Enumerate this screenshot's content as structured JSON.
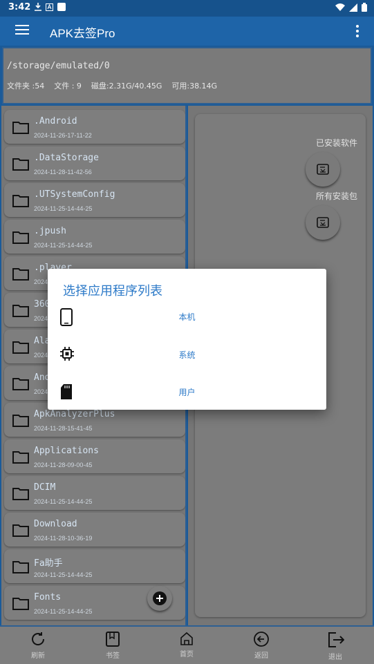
{
  "statusbar": {
    "time": "3:42"
  },
  "appbar": {
    "title": "APK去签Pro"
  },
  "path": {
    "current": "/storage/emulated/0",
    "folders": "文件夹 :54",
    "files": "文件 : 9",
    "disk": "磁盘:2.31G/40.45G",
    "free": "可用:38.14G"
  },
  "files": [
    {
      "name": ".Android",
      "date": "2024-11-26-17-11-22"
    },
    {
      "name": ".DataStorage",
      "date": "2024-11-28-11-42-56"
    },
    {
      "name": ".UTSystemConfig",
      "date": "2024-11-25-14-44-25"
    },
    {
      "name": ".jpush",
      "date": "2024-11-25-14-44-25"
    },
    {
      "name": ".player",
      "date": "2024"
    },
    {
      "name": "360",
      "date": "2024"
    },
    {
      "name": "Ala",
      "date": "2024"
    },
    {
      "name": "And",
      "date": "2024"
    },
    {
      "name": "ApkAnalyzerPlus",
      "date": "2024-11-28-15-41-45"
    },
    {
      "name": "Applications",
      "date": "2024-11-28-09-00-45"
    },
    {
      "name": "DCIM",
      "date": "2024-11-25-14-44-25"
    },
    {
      "name": "Download",
      "date": "2024-11-28-10-36-19"
    },
    {
      "name": "Fa助手",
      "date": "2024-11-25-14-44-25"
    },
    {
      "name": "Fonts",
      "date": "2024-11-25-14-44-25"
    }
  ],
  "right": {
    "installed_label": "已安装软件",
    "packages_label": "所有安装包"
  },
  "bottom_nav": {
    "refresh": "刷新",
    "bookmarks": "书签",
    "home": "首页",
    "back": "返回",
    "exit": "退出"
  },
  "dialog": {
    "title": "选择应用程序列表",
    "options": [
      "本机",
      "系统",
      "用户"
    ]
  }
}
